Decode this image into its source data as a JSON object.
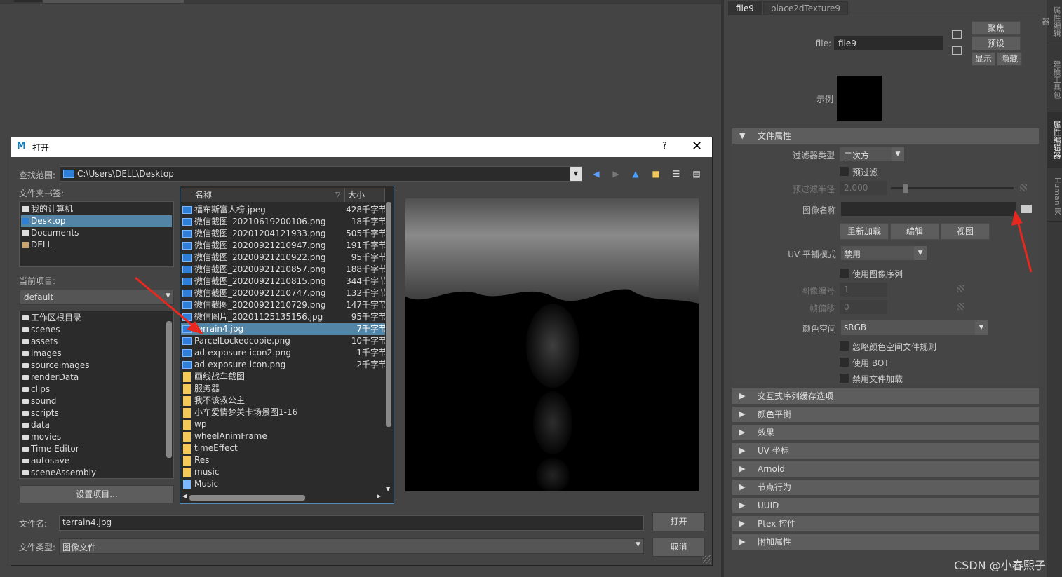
{
  "attribute_editor": {
    "tabs": [
      "file9",
      "place2dTexture9"
    ],
    "side_tabs": [
      "属性编辑器",
      "建模工具包",
      "属性编辑器",
      "Human IK"
    ],
    "file_label": "file:",
    "file_value": "file9",
    "buttons": {
      "focus": "聚焦",
      "presets": "预设",
      "show": "显示",
      "hide": "隐藏"
    },
    "sample_label": "示例",
    "file_attributes": {
      "title": "文件属性",
      "filter_type_label": "过滤器类型",
      "filter_type_value": "二次方",
      "prefilter_label": "预过滤",
      "prefilter_radius_label": "预过滤半径",
      "prefilter_radius_value": "2.000",
      "image_name_label": "图像名称",
      "image_name_value": "",
      "reload": "重新加载",
      "edit": "编辑",
      "view": "视图",
      "uv_tiling_label": "UV 平铺模式",
      "uv_tiling_value": "禁用",
      "use_image_seq": "使用图像序列",
      "image_number_label": "图像编号",
      "image_number_value": "1",
      "frame_offset_label": "帧偏移",
      "frame_offset_value": "0",
      "color_space_label": "颜色空间",
      "color_space_value": "sRGB",
      "ignore_cs_rules": "忽略颜色空间文件规则",
      "use_bot": "使用 BOT",
      "disable_file_load": "禁用文件加载"
    },
    "sections": [
      "交互式序列缓存选项",
      "颜色平衡",
      "效果",
      "UV 坐标",
      "Arnold",
      "节点行为",
      "UUID",
      "Ptex 控件",
      "附加属性"
    ]
  },
  "dialog": {
    "title": "打开",
    "help": "?",
    "close": "✕",
    "look_in_label": "查找范围:",
    "path": "C:\\Users\\DELL\\Desktop",
    "bookmarks_label": "文件夹书签:",
    "bookmarks": [
      "我的计算机",
      "Desktop",
      "Documents",
      "DELL"
    ],
    "current_project_label": "当前项目:",
    "current_project": "default",
    "project_dirs": [
      "工作区根目录",
      "scenes",
      "assets",
      "images",
      "sourceimages",
      "renderData",
      "clips",
      "sound",
      "scripts",
      "data",
      "movies",
      "Time Editor",
      "autosave",
      "sceneAssembly"
    ],
    "set_project": "设置项目...",
    "col_name": "名称",
    "col_size": "大小",
    "files": [
      {
        "name": "福布斯富人榜.jpeg",
        "size": "428千字节",
        "kind": "img"
      },
      {
        "name": "微信截图_20210619200106.png",
        "size": "18千字节",
        "kind": "img"
      },
      {
        "name": "微信截图_20201204121933.png",
        "size": "505千字节",
        "kind": "img"
      },
      {
        "name": "微信截图_20200921210947.png",
        "size": "191千字节",
        "kind": "img"
      },
      {
        "name": "微信截图_20200921210922.png",
        "size": "95千字节",
        "kind": "img"
      },
      {
        "name": "微信截图_20200921210857.png",
        "size": "188千字节",
        "kind": "img"
      },
      {
        "name": "微信截图_20200921210815.png",
        "size": "344千字节",
        "kind": "img"
      },
      {
        "name": "微信截图_20200921210747.png",
        "size": "132千字节",
        "kind": "img"
      },
      {
        "name": "微信截图_20200921210729.png",
        "size": "147千字节",
        "kind": "img"
      },
      {
        "name": "微信图片_20201125135156.jpg",
        "size": "95千字节",
        "kind": "img"
      },
      {
        "name": "terrain4.jpg",
        "size": "7千字节",
        "kind": "img"
      },
      {
        "name": "ParcelLockedcopie.png",
        "size": "10千字节",
        "kind": "img"
      },
      {
        "name": "ad-exposure-icon2.png",
        "size": "1千字节",
        "kind": "img"
      },
      {
        "name": "ad-exposure-icon.png",
        "size": "2千字节",
        "kind": "img"
      },
      {
        "name": "画线战车截图",
        "size": "",
        "kind": "folder"
      },
      {
        "name": "服务器",
        "size": "",
        "kind": "folder"
      },
      {
        "name": "我不该救公主",
        "size": "",
        "kind": "folder"
      },
      {
        "name": "小车爱情梦关卡场景图1-16",
        "size": "",
        "kind": "folder"
      },
      {
        "name": "wp",
        "size": "",
        "kind": "folder"
      },
      {
        "name": "wheelAnimFrame",
        "size": "",
        "kind": "folder"
      },
      {
        "name": "timeEffect",
        "size": "",
        "kind": "folder"
      },
      {
        "name": "Res",
        "size": "",
        "kind": "folder"
      },
      {
        "name": "music",
        "size": "",
        "kind": "folder"
      },
      {
        "name": "Music",
        "size": "",
        "kind": "music"
      }
    ],
    "filename_label": "文件名:",
    "filename_value": "terrain4.jpg",
    "filetype_label": "文件类型:",
    "filetype_value": "图像文件",
    "open": "打开",
    "cancel": "取消"
  },
  "watermark": "CSDN @小春熙子",
  "colors": {
    "selection": "#5285a6",
    "annotation_arrow": "#e8281e"
  }
}
